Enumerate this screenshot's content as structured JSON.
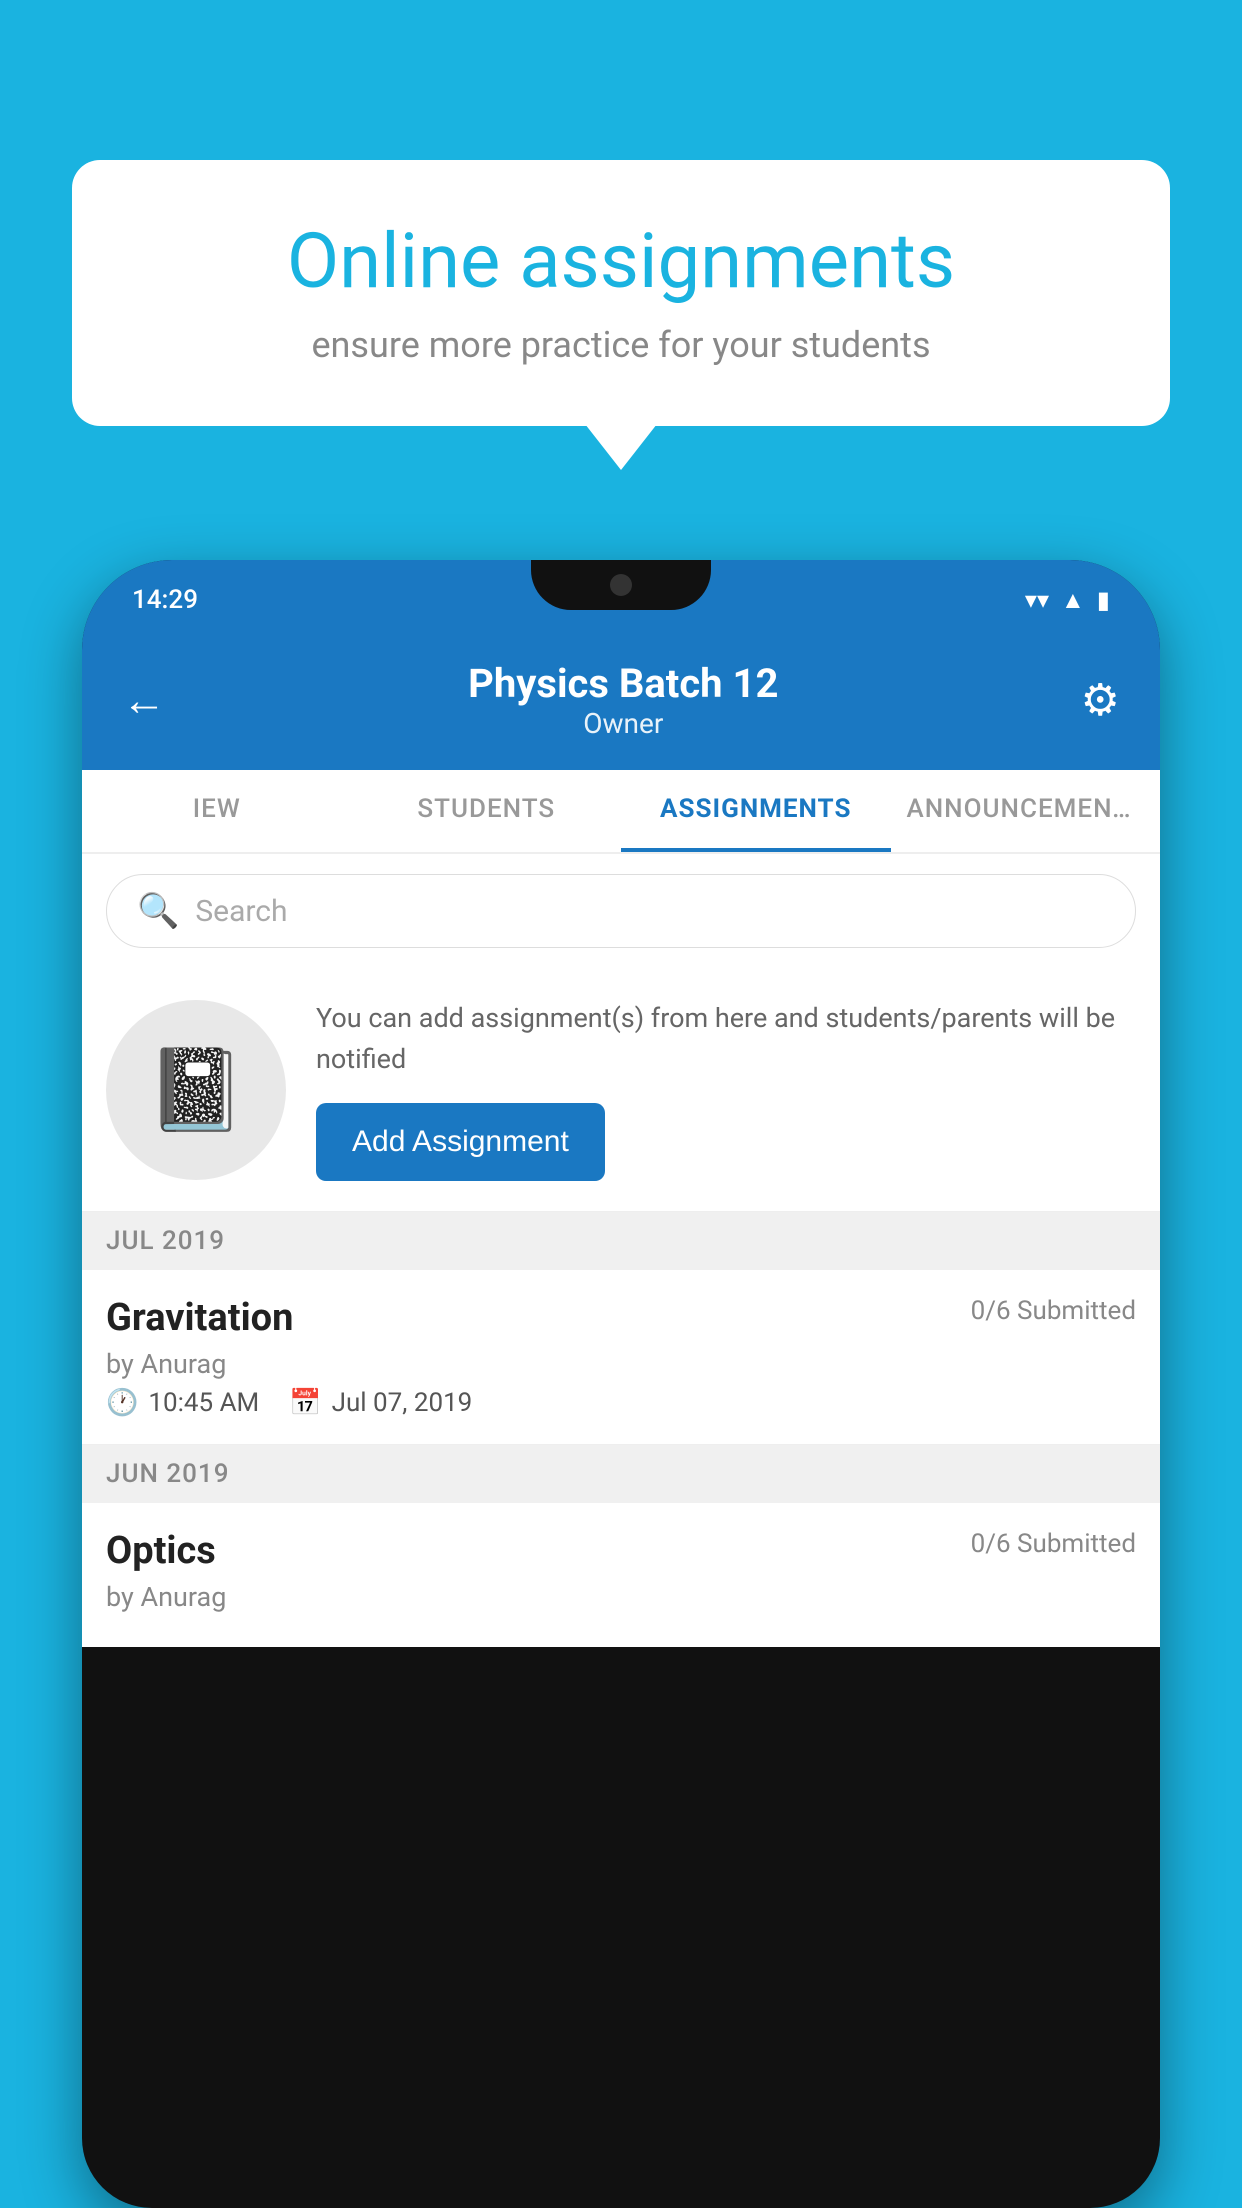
{
  "background_color": "#1ab3e0",
  "speech_bubble": {
    "title": "Online assignments",
    "subtitle": "ensure more practice for your students"
  },
  "phone": {
    "status_bar": {
      "time": "14:29",
      "wifi": "▼",
      "signal": "▲",
      "battery": "▮"
    },
    "header": {
      "title": "Physics Batch 12",
      "subtitle": "Owner",
      "back_label": "←",
      "gear_label": "⚙"
    },
    "tabs": [
      {
        "label": "IEW",
        "active": false
      },
      {
        "label": "STUDENTS",
        "active": false
      },
      {
        "label": "ASSIGNMENTS",
        "active": true
      },
      {
        "label": "ANNOUNCEMENTS",
        "active": false
      }
    ],
    "search": {
      "placeholder": "Search"
    },
    "assignment_promo": {
      "description": "You can add assignment(s) from here and students/parents will be notified",
      "button_label": "Add Assignment"
    },
    "sections": [
      {
        "month": "JUL 2019",
        "assignments": [
          {
            "name": "Gravitation",
            "submitted": "0/6 Submitted",
            "by": "by Anurag",
            "time": "10:45 AM",
            "date": "Jul 07, 2019"
          }
        ]
      },
      {
        "month": "JUN 2019",
        "assignments": [
          {
            "name": "Optics",
            "submitted": "0/6 Submitted",
            "by": "by Anurag",
            "time": "",
            "date": ""
          }
        ]
      }
    ]
  }
}
